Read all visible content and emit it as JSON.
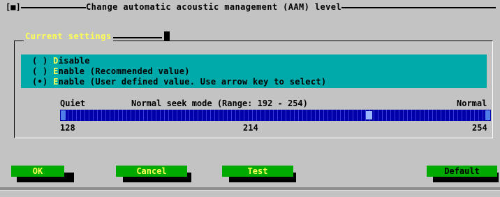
{
  "window": {
    "close_label": "[■]",
    "title": "Change automatic acoustic management (AAM) level"
  },
  "group": {
    "title": "Current settings"
  },
  "options": [
    {
      "mark": "( )",
      "hotkey": "D",
      "rest": "isable"
    },
    {
      "mark": "( )",
      "hotkey": "E",
      "rest": "nable (Recommended value)"
    },
    {
      "mark": "(•)",
      "hotkey": "E",
      "rest": "nable (User defined value. Use arrow key to select)"
    }
  ],
  "slider": {
    "left_label": "Quiet",
    "caption": "Normal seek mode (Range: 192 - 254)",
    "right_label": "Normal",
    "min_value": "128",
    "mid_value": "214",
    "max_value": "254",
    "current_fraction": 0.72
  },
  "buttons": {
    "ok": "OK",
    "cancel": "Cancel",
    "test": "Test",
    "default": "Default"
  },
  "colors": {
    "panel": "#00aaaa",
    "track": "#0000aa",
    "button": "#00aa00",
    "hotkey": "#ffff55"
  }
}
